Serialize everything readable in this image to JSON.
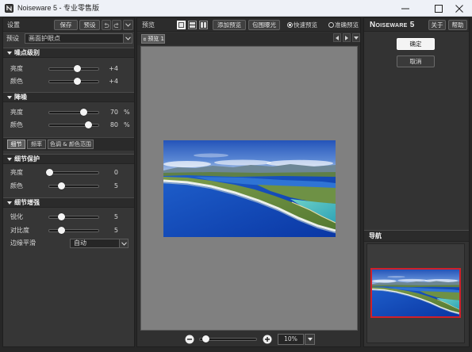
{
  "window": {
    "title": "Noiseware 5 - 专业零售版"
  },
  "icons": {
    "app": "noiseware-app-icon",
    "minimize": "minimize-icon",
    "maximize": "maximize-icon",
    "close": "close-icon",
    "undo": "undo-icon",
    "redo": "redo-icon",
    "menu": "chevron-down-icon",
    "section_toggle": "triangle-down-icon",
    "tab_prev": "arrow-left-icon",
    "tab_next": "arrow-right-icon",
    "zoom_out": "minus-circle-icon",
    "zoom_in": "plus-circle-icon",
    "preview_tab": "image-icon"
  },
  "colors": {
    "navigator_frame": "#d0202a",
    "ok_button": "#f4f4f4",
    "preview_background": "#808080",
    "panel_background": "#363636"
  },
  "settings": {
    "title": "设置",
    "save_label": "保存",
    "preset_button_label": "预设",
    "preset_label": "预设",
    "preset_value": "画面护眼点",
    "noise_level": {
      "title": "噪点级别",
      "rows": [
        {
          "label": "亮度",
          "value": "+4",
          "unit": "",
          "level": 0.58
        },
        {
          "label": "颜色",
          "value": "+4",
          "unit": "",
          "level": 0.58
        }
      ]
    },
    "noise_reduction": {
      "title": "降噪",
      "rows": [
        {
          "label": "亮度",
          "value": "70",
          "unit": "%",
          "level": 0.7
        },
        {
          "label": "颜色",
          "value": "80",
          "unit": "%",
          "level": 0.8
        }
      ]
    },
    "tabs": [
      {
        "label": "细节",
        "active": true
      },
      {
        "label": "频率",
        "active": false
      },
      {
        "label": "色调 & 颜色范围",
        "active": false
      }
    ],
    "detail_protection": {
      "title": "细节保护",
      "rows": [
        {
          "label": "亮度",
          "value": "0",
          "unit": "",
          "level": 0.0
        },
        {
          "label": "颜色",
          "value": "5",
          "unit": "",
          "level": 0.25
        }
      ]
    },
    "detail_enhancement": {
      "title": "细节增强",
      "rows": [
        {
          "label": "锐化",
          "value": "5",
          "unit": "",
          "level": 0.25
        },
        {
          "label": "对比度",
          "value": "5",
          "unit": "",
          "level": 0.25
        }
      ],
      "edge_smoothing_label": "边缘平滑",
      "edge_smoothing_value": "自动"
    }
  },
  "preview": {
    "title": "预览",
    "view_modes": [
      {
        "icon": "single-view-icon",
        "selected": true
      },
      {
        "icon": "split-horizontal-icon",
        "selected": false
      },
      {
        "icon": "split-vertical-icon",
        "selected": false
      }
    ],
    "add_preview_label": "添加预览",
    "bracket_label": "包围曝光",
    "render_modes": [
      {
        "label": "快速预览",
        "selected": true
      },
      {
        "label": "准确预览",
        "selected": false
      }
    ],
    "tab_label": "预览 1",
    "zoom_value": "10%",
    "zoom_level": 0.1
  },
  "side": {
    "brand": "Noiseware 5",
    "about_label": "关于",
    "help_label": "帮助",
    "ok_label": "确定",
    "cancel_label": "取消",
    "navigator_title": "导航"
  }
}
